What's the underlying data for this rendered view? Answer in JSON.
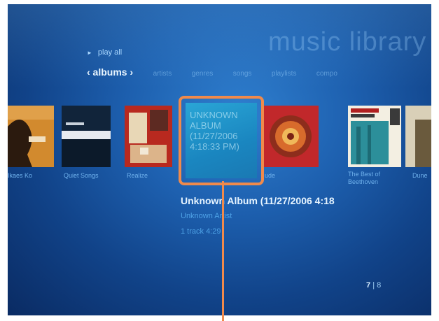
{
  "header": {
    "title": "music library",
    "play_all": "play all",
    "nav_items": [
      "‹ albums ›",
      "artists",
      "genres",
      "songs",
      "playlists",
      "compo"
    ]
  },
  "albums": [
    {
      "label": "Ikaes Ko"
    },
    {
      "label": "Quiet Songs"
    },
    {
      "label": "Realize"
    },
    {
      "label": "Unknown Album (11/27/2006 4:18:33 PM)"
    },
    {
      "label": "ude"
    },
    {
      "label_line1": "The Best of",
      "label_line2": "Beethoven"
    },
    {
      "label": "Dune"
    }
  ],
  "selected": {
    "tile_lines": [
      "UNKNOWN",
      "ALBUM",
      "(11/27/2006",
      "4:18:33 PM)"
    ],
    "title": "Unknown Album (11/27/2006 4:18",
    "artist": "Unknown Artist",
    "tracks": "1 track 4:29"
  },
  "pager": {
    "current": "7",
    "separator": "|",
    "total": "8"
  },
  "colors": {
    "accent": "#f08a4b",
    "background": "#1d5fae"
  }
}
